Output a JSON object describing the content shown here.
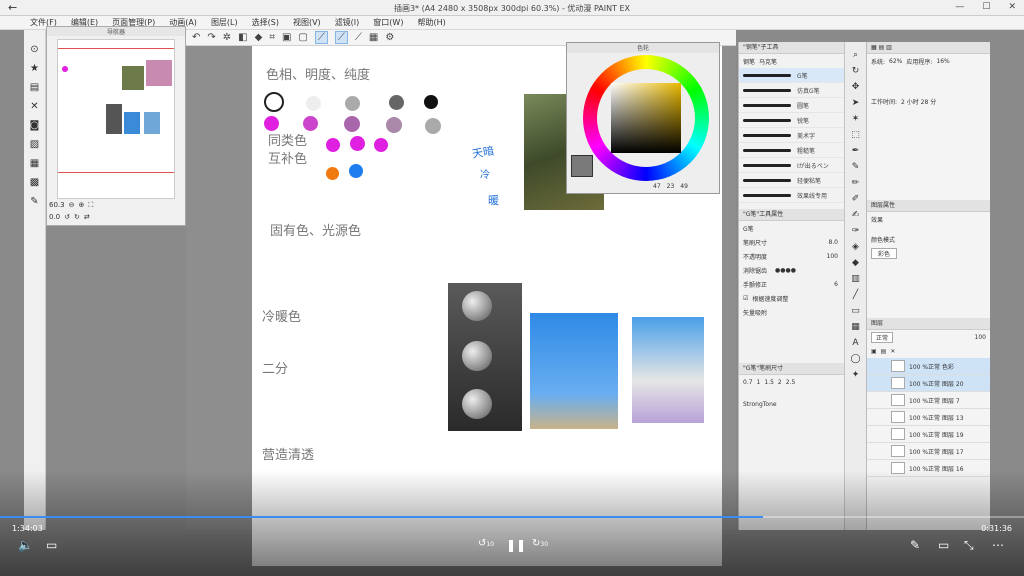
{
  "window": {
    "title": "插画3* (A4 2480 x 3508px 300dpi 60.3%) - 优动漫 PAINT EX"
  },
  "menu": [
    "文件(F)",
    "编辑(E)",
    "页面管理(P)",
    "动画(A)",
    "图层(L)",
    "选择(S)",
    "视图(V)",
    "滤镜(I)",
    "窗口(W)",
    "帮助(H)"
  ],
  "navigator": {
    "title": "导航器",
    "zoom": "60.3",
    "angle": "0.0"
  },
  "canvas": {
    "labels": [
      "色相、明度、纯度",
      "同类色",
      "互补色",
      "固有色、光源色",
      "冷暖色",
      "二分",
      "营造清透"
    ],
    "handwriting": [
      "天暗",
      "冷",
      "暖"
    ],
    "dots_row1": [
      "#ffffff",
      "#eeeeee",
      "#aaaaaa",
      "#666666",
      "#111111"
    ],
    "dots_row2": [
      "#e020e0",
      "#cc44cc",
      "#aa66aa",
      "#aa88aa",
      "#aaaaaa"
    ],
    "dots_row3": [
      "#e020e0",
      "#e020e0",
      "#e020e0"
    ],
    "dots_row4": [
      "#f07a10",
      "#1e7ef0"
    ]
  },
  "colorpanel": {
    "title": "色轮",
    "h": "47",
    "s": "23",
    "v": "49"
  },
  "brushpanel": {
    "tabs": [
      "钢笔",
      "马克笔"
    ],
    "tabgroup_label": "\"钢笔\"子工具",
    "brushes": [
      "G笔",
      "仿真G笔",
      "圆笔",
      "锐笔",
      "美术字",
      "粗糙笔",
      "Iが出るペン",
      "轻便粘笔",
      "效果线专用"
    ],
    "prop_title": "\"G笔\"工具属性",
    "prop_tool": "G笔",
    "brush_size_label": "笔刷尺寸",
    "brush_size": "8.0",
    "opacity_label": "不透明度",
    "opacity": "100",
    "aa_label": "消除锯齿",
    "stabilize_label": "手颤修正",
    "stabilize": "6",
    "pressure_label": "根据速度调整",
    "vector_label": "矢量吸附",
    "size_panel_title": "\"G笔\"笔刷尺寸",
    "sizes": [
      "0.7",
      "1",
      "1.5",
      "2",
      "2.5"
    ],
    "palette_label": "StrongTone"
  },
  "infopanel": {
    "system_label": "系统:",
    "system_value": "62%",
    "app_label": "应用程序:",
    "app_value": "16%",
    "work_time_label": "工作时间:",
    "work_time": "2 小时 28 分"
  },
  "layerprop": {
    "title": "图层属性",
    "effect_label": "效果",
    "color_mode_label": "颜色模式",
    "color_mode": "彩色"
  },
  "layers": {
    "title": "图层",
    "blend": "正常",
    "opacity": "100",
    "items": [
      {
        "name": "100 %正常 色彩"
      },
      {
        "name": "100 %正常 图层 20"
      },
      {
        "name": "100 %正常 图层 7"
      },
      {
        "name": "100 %正常 图层 13"
      },
      {
        "name": "100 %正常 图层 19"
      },
      {
        "name": "100 %正常 图层 17"
      },
      {
        "name": "100 %正常 图层 16"
      }
    ]
  },
  "video": {
    "current": "1:34:03",
    "total": "0:31:36",
    "progress": 0.745,
    "rewind": "10",
    "forward": "30"
  },
  "colors": {
    "accent": "#3b8cf0",
    "selection": "#cfe3f7"
  }
}
